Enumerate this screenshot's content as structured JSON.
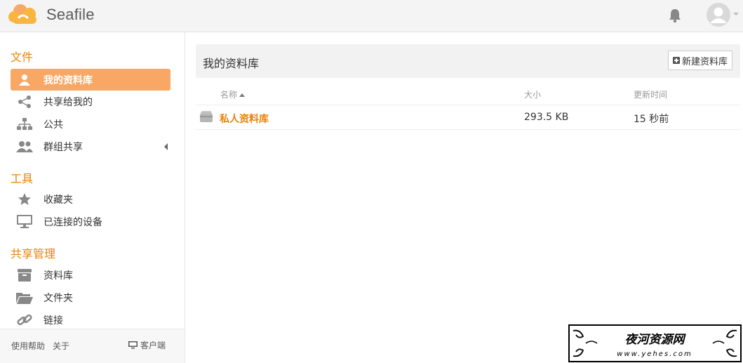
{
  "header": {
    "brand": "Seafile",
    "icons": [
      "cloud-logo-icon",
      "bell-icon",
      "avatar-icon"
    ]
  },
  "sidebar": {
    "sections": [
      {
        "title": "文件",
        "items": [
          {
            "label": "我的资料库",
            "icon": "user-icon",
            "active": true
          },
          {
            "label": "共享给我的",
            "icon": "share-icon"
          },
          {
            "label": "公共",
            "icon": "org-chart-icon"
          },
          {
            "label": "群组共享",
            "icon": "group-icon"
          }
        ]
      },
      {
        "title": "工具",
        "items": [
          {
            "label": "收藏夹",
            "icon": "star-icon"
          },
          {
            "label": "已连接的设备",
            "icon": "monitor-icon"
          }
        ]
      },
      {
        "title": "共享管理",
        "items": [
          {
            "label": "资料库",
            "icon": "archive-icon"
          },
          {
            "label": "文件夹",
            "icon": "folder-open-icon"
          },
          {
            "label": "链接",
            "icon": "link-icon"
          }
        ]
      }
    ],
    "footer": {
      "help": "使用帮助",
      "about": "关于",
      "client": "客户端"
    }
  },
  "main": {
    "title": "我的资料库",
    "new_library_label": "新建资料库",
    "columns": {
      "name": "名称",
      "size": "大小",
      "updated": "更新时间"
    },
    "rows": [
      {
        "name": "私人资料库",
        "size": "293.5 KB",
        "updated": "15 秒前"
      }
    ]
  },
  "watermark": {
    "text": "夜河资源网",
    "url": "www.yehes.com"
  },
  "colors": {
    "accent": "#eb8205",
    "active_bg": "#f8a765"
  }
}
